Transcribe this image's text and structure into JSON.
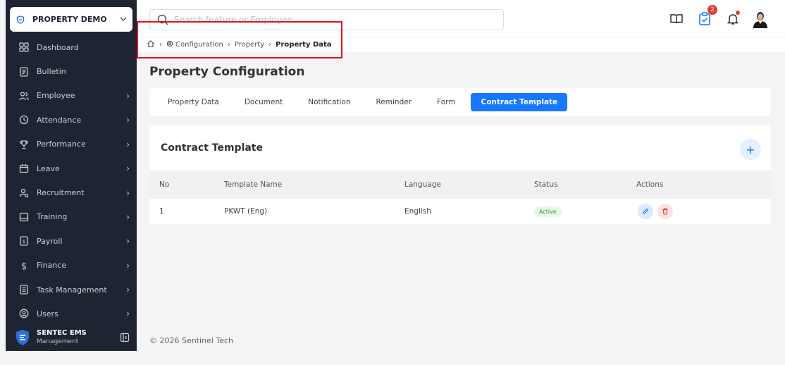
{
  "sidebar": {
    "org": "PROPERTY DEMO",
    "items": [
      {
        "label": "Dashboard",
        "icon": "dashboard-icon",
        "has_arrow": false
      },
      {
        "label": "Bulletin",
        "icon": "bulletin-icon",
        "has_arrow": false
      },
      {
        "label": "Employee",
        "icon": "employee-icon",
        "has_arrow": true
      },
      {
        "label": "Attendance",
        "icon": "clock-icon",
        "has_arrow": true
      },
      {
        "label": "Performance",
        "icon": "trophy-icon",
        "has_arrow": true
      },
      {
        "label": "Leave",
        "icon": "calendar-icon",
        "has_arrow": true
      },
      {
        "label": "Recruitment",
        "icon": "recruitment-icon",
        "has_arrow": true
      },
      {
        "label": "Training",
        "icon": "training-icon",
        "has_arrow": true
      },
      {
        "label": "Payroll",
        "icon": "payroll-icon",
        "has_arrow": true
      },
      {
        "label": "Finance",
        "icon": "dollar-icon",
        "has_arrow": true
      },
      {
        "label": "Task Management",
        "icon": "task-icon",
        "has_arrow": true
      },
      {
        "label": "Users",
        "icon": "users-icon",
        "has_arrow": true
      }
    ],
    "brand_name": "SENTEC EMS",
    "brand_sub": "Management"
  },
  "topbar": {
    "search_placeholder": "Search feature or Employee",
    "task_badge": "2"
  },
  "breadcrumb": {
    "items": [
      "Configuration",
      "Property",
      "Property Data"
    ]
  },
  "main": {
    "title": "Property Configuration",
    "tabs": [
      "Property Data",
      "Document",
      "Notification",
      "Reminder",
      "Form",
      "Contract Template"
    ],
    "active_tab": "Contract Template",
    "card_title": "Contract Template",
    "add_label": "+",
    "columns": [
      "No",
      "Template Name",
      "Language",
      "Status",
      "Actions"
    ],
    "rows": [
      {
        "no": "1",
        "name": "PKWT (Eng)",
        "language": "English",
        "status": "Active"
      }
    ]
  },
  "footer": "© 2026 Sentinel Tech",
  "colors": {
    "sidebar_bg": "#1f2433",
    "accent": "#1677ff",
    "highlight": "#e0121c",
    "badge": "#e53935"
  }
}
